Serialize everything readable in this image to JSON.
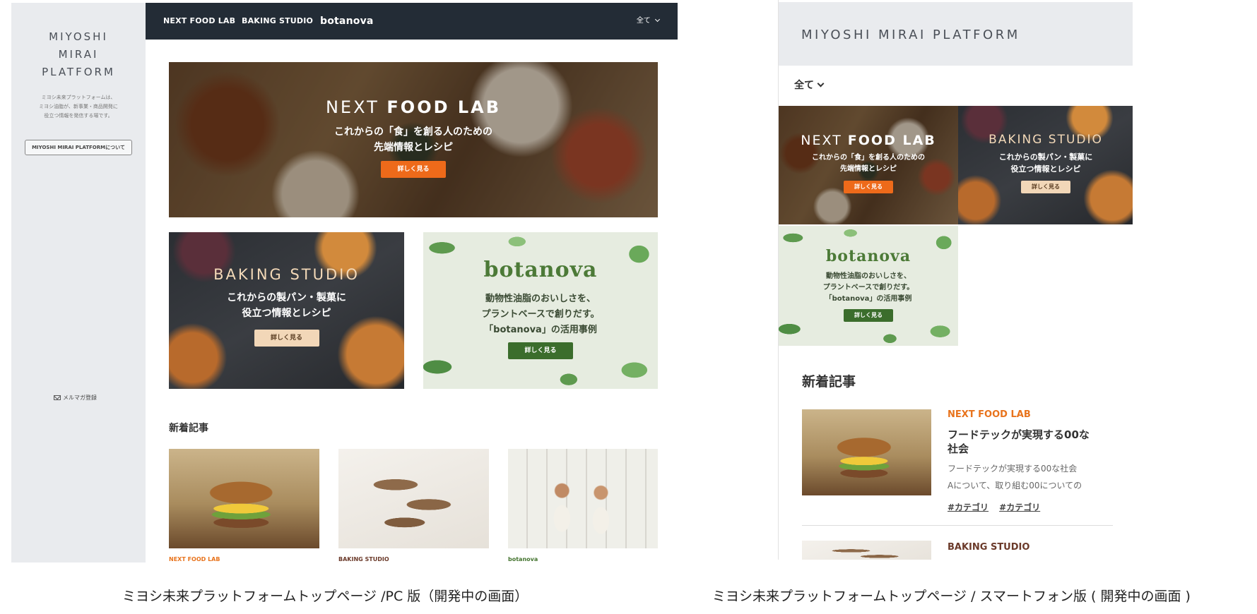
{
  "pc": {
    "sidebar": {
      "brand": [
        "MIYOSHI",
        "MIRAI",
        "PLATFORM"
      ],
      "description": [
        "ミヨシ未来プラットフォームは、",
        "ミヨシ油脂が、新事業・商品開発に",
        "役立つ情報を発信する場です。"
      ],
      "about_button": "MIYOSHI MIRAI PLATFORMについて",
      "newsletter": "メルマガ登録"
    },
    "nav": {
      "items": [
        "NEXT FOOD LAB",
        "BAKING STUDIO"
      ],
      "logo": "botanova",
      "filter": "全て"
    },
    "banners": {
      "nfl": {
        "title_light": "NEXT",
        "title_bold": "FOOD LAB",
        "subtitle": "これからの「食」を創る人のための\n先端情報とレシピ",
        "button": "詳しく見る"
      },
      "bake": {
        "title": "BAKING STUDIO",
        "subtitle": "これからの製パン・製菓に\n役立つ情報とレシピ",
        "button": "詳しく見る"
      },
      "bota": {
        "logo": "botanova",
        "subtitle": "動物性油脂のおいしさを、\nプラントベースで創りだす。\n「botanova」の活用事例",
        "button": "詳しく見る"
      }
    },
    "news": {
      "title": "新着記事",
      "items": [
        {
          "category": "NEXT FOOD LAB",
          "color": "#e8731c"
        },
        {
          "category": "BAKING STUDIO",
          "color": "#6b3a2a"
        },
        {
          "category": "botanova",
          "color": "#44742f"
        }
      ]
    }
  },
  "sp": {
    "brand": "MIYOSHI MIRAI PLATFORM",
    "filter": "全て",
    "banners": {
      "nfl": {
        "title_light": "NEXT",
        "title_bold": "FOOD LAB",
        "subtitle": "これからの「食」を創る人のための\n先端情報とレシピ",
        "button": "詳しく見る"
      },
      "bake": {
        "title": "BAKING STUDIO",
        "subtitle": "これからの製パン・製菓に\n役立つ情報とレシピ",
        "button": "詳しく見る"
      },
      "bota": {
        "logo": "botanova",
        "subtitle": "動物性油脂のおいしさを、\nプラントベースで創りだす。\n「botanova」の活用事例",
        "button": "詳しく見る"
      }
    },
    "news": {
      "title": "新着記事",
      "article1": {
        "category": "NEXT FOOD LAB",
        "title": [
          "フードテックが実現する00な",
          "社会"
        ],
        "desc": [
          "フードテックが実現する00な社会",
          "Aについて、取り組む00についての"
        ],
        "tags": [
          "#カテゴリ",
          "#カテゴリ"
        ]
      },
      "article2": {
        "category": "BAKING STUDIO"
      }
    }
  },
  "captions": {
    "pc": "ミヨシ未来プラットフォームトップページ /PC 版（開発中の画面）",
    "sp": "ミヨシ未来プラットフォームトップページ / スマートフォン版 ( 開発中の画面 )"
  }
}
